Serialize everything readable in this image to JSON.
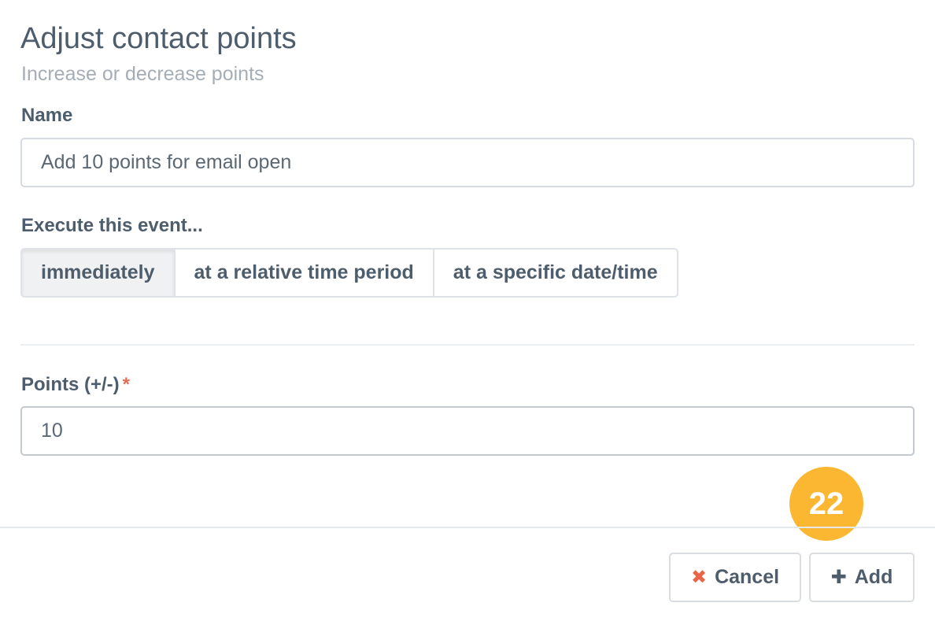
{
  "header": {
    "title": "Adjust contact points",
    "subtitle": "Increase or decrease points"
  },
  "form": {
    "name": {
      "label": "Name",
      "value": "Add 10 points for email open"
    },
    "execute": {
      "label": "Execute this event...",
      "options": [
        "immediately",
        "at a relative time period",
        "at a specific date/time"
      ],
      "selected": "immediately"
    },
    "points": {
      "label": "Points (+/-)",
      "required_marker": "*",
      "value": "10"
    }
  },
  "footer": {
    "cancel_label": "Cancel",
    "add_label": "Add",
    "cancel_icon": "close-icon",
    "add_icon": "plus-icon"
  },
  "step_badge": "22",
  "colors": {
    "text": "#4e5d6c",
    "subtitle": "#a5adb6",
    "required": "#e06e56",
    "cancel_icon": "#e8654a",
    "badge": "#fbb731"
  }
}
